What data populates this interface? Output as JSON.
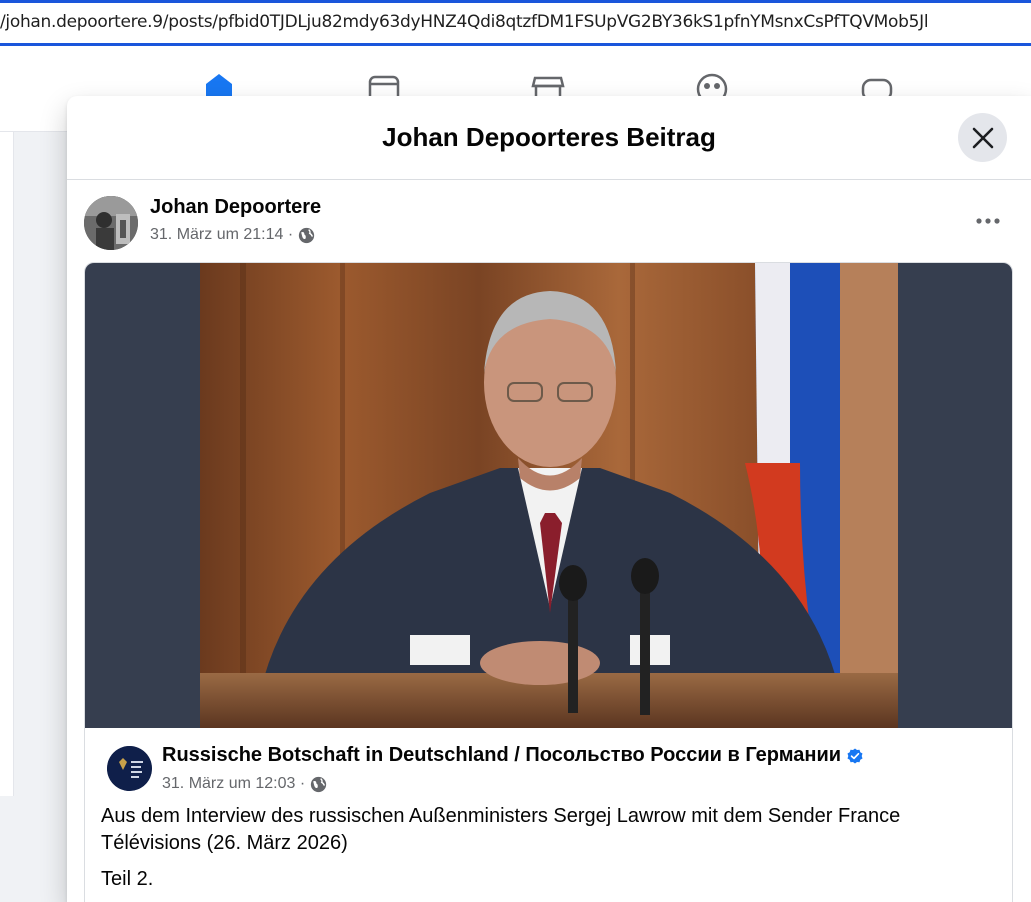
{
  "browser": {
    "url": "/johan.depoortere.9/posts/pfbid0TJDLju82mdy63dyHNZ4Qdi8qtzfDM1FSUpVG2BY36kS1pfnYMsnxCsPfTQVMob5Jl"
  },
  "modal": {
    "title": "Johan Depoorteres Beitrag"
  },
  "post": {
    "author": "Johan Depoortere",
    "timestamp": "31. März um 21:14 ·",
    "visibility_icon": "globe-icon"
  },
  "shared_post": {
    "page_name": "Russische Botschaft in Deutschland / Посольство России в Германии",
    "verified": true,
    "timestamp": "31. März um 12:03 ·",
    "text": "Aus dem Interview des russischen Außenministers Sergej Lawrow mit dem Sender France Télévisions (26. März 2026)",
    "text2": "Teil 2."
  },
  "colors": {
    "accent": "#1877f2",
    "url_focus": "#1a56db"
  }
}
